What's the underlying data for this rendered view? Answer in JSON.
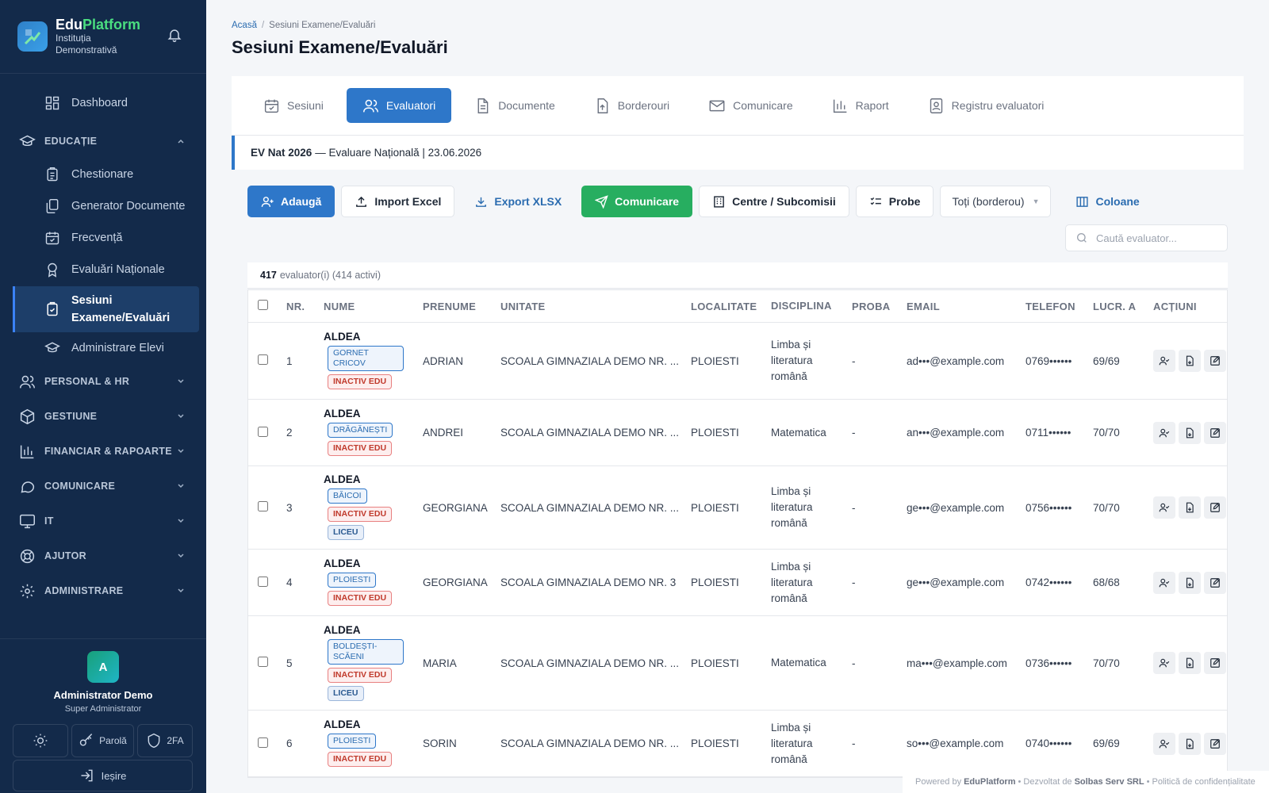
{
  "brand": {
    "name_a": "Edu",
    "name_b": "Platform",
    "sub": "Instituția Demonstrativă"
  },
  "sidebar": {
    "dashboard": "Dashboard",
    "section_educatie": "EDUCAȚIE",
    "edu_items": [
      "Chestionare",
      "Generator Documente",
      "Frecvență",
      "Evaluări Naționale"
    ],
    "active_item": "Sesiuni Examene/Evaluări",
    "admin_elevi": "Administrare Elevi",
    "sections": [
      "PERSONAL & HR",
      "GESTIUNE",
      "FINANCIAR & RAPOARTE",
      "COMUNICARE",
      "IT",
      "AJUTOR",
      "ADMINISTRARE"
    ]
  },
  "user": {
    "initial": "A",
    "name": "Administrator Demo",
    "role": "Super Administrator",
    "btn_parola": "Parolă",
    "btn_2fa": "2FA",
    "logout": "Ieșire"
  },
  "breadcrumb": {
    "home": "Acasă",
    "current": "Sesiuni Examene/Evaluări"
  },
  "page_title": "Sesiuni Examene/Evaluări",
  "tabs": [
    "Sesiuni",
    "Evaluatori",
    "Documente",
    "Borderouri",
    "Comunicare",
    "Raport",
    "Registru evaluatori"
  ],
  "session": {
    "code": "EV Nat 2026",
    "desc": "— Evaluare Națională | 23.06.2026"
  },
  "toolbar": {
    "add": "Adaugă",
    "import": "Import Excel",
    "export": "Export XLSX",
    "comm": "Comunicare",
    "centre": "Centre / Subcomisii",
    "probe": "Probe",
    "filter": "Toți (borderou)",
    "columns": "Coloane"
  },
  "search": {
    "placeholder": "Caută evaluator..."
  },
  "count": {
    "total": "417",
    "label": "evaluator(i) (414 activi)"
  },
  "table": {
    "headers": [
      "NR.",
      "NUME",
      "PRENUME",
      "UNITATE",
      "LOCALITATE",
      "DISCIPLINA",
      "PROBA",
      "EMAIL",
      "TELEFON",
      "LUCR. A",
      "ACȚIUNI"
    ],
    "rows": [
      {
        "nr": "1",
        "nume": "ALDEA",
        "loc_badge": "GORNET CRICOV",
        "status": "INACTIV EDU",
        "liceu": "",
        "prenume": "ADRIAN",
        "unitate": "SCOALA GIMNAZIALA DEMO NR. ...",
        "localitate": "PLOIESTI",
        "disciplina": "Limba și literatura română",
        "proba": "-",
        "email": "ad•••@example.com",
        "telefon": "0769••••••",
        "lucr": "69/69"
      },
      {
        "nr": "2",
        "nume": "ALDEA",
        "loc_badge": "DRĂGĂNEȘTI",
        "status": "INACTIV EDU",
        "liceu": "",
        "prenume": "ANDREI",
        "unitate": "SCOALA GIMNAZIALA DEMO NR. ...",
        "localitate": "PLOIESTI",
        "disciplina": "Matematica",
        "proba": "-",
        "email": "an•••@example.com",
        "telefon": "0711••••••",
        "lucr": "70/70"
      },
      {
        "nr": "3",
        "nume": "ALDEA",
        "loc_badge": "BĂICOI",
        "status": "INACTIV EDU",
        "liceu": "LICEU",
        "prenume": "GEORGIANA",
        "unitate": "SCOALA GIMNAZIALA DEMO NR. ...",
        "localitate": "PLOIESTI",
        "disciplina": "Limba și literatura română",
        "proba": "-",
        "email": "ge•••@example.com",
        "telefon": "0756••••••",
        "lucr": "70/70"
      },
      {
        "nr": "4",
        "nume": "ALDEA",
        "loc_badge": "PLOIESTI",
        "status": "INACTIV EDU",
        "liceu": "",
        "prenume": "GEORGIANA",
        "unitate": "SCOALA GIMNAZIALA DEMO NR. 3",
        "localitate": "PLOIESTI",
        "disciplina": "Limba și literatura română",
        "proba": "-",
        "email": "ge•••@example.com",
        "telefon": "0742••••••",
        "lucr": "68/68"
      },
      {
        "nr": "5",
        "nume": "ALDEA",
        "loc_badge": "BOLDEȘTI-SCĂENI",
        "status": "INACTIV EDU",
        "liceu": "LICEU",
        "prenume": "MARIA",
        "unitate": "SCOALA GIMNAZIALA DEMO NR. ...",
        "localitate": "PLOIESTI",
        "disciplina": "Matematica",
        "proba": "-",
        "email": "ma•••@example.com",
        "telefon": "0736••••••",
        "lucr": "70/70"
      },
      {
        "nr": "6",
        "nume": "ALDEA",
        "loc_badge": "PLOIESTI",
        "status": "INACTIV EDU",
        "liceu": "",
        "prenume": "SORIN",
        "unitate": "SCOALA GIMNAZIALA DEMO NR. ...",
        "localitate": "PLOIESTI",
        "disciplina": "Limba și literatura română",
        "proba": "-",
        "email": "so•••@example.com",
        "telefon": "0740••••••",
        "lucr": "69/69"
      }
    ]
  },
  "footer": {
    "powered": "Powered by",
    "brand": "EduPlatform",
    "dev": "• Dezvoltat de",
    "company": "Solbas Serv SRL",
    "privacy": "• Politică de confidențialitate"
  },
  "colors": {
    "sidebar": "#132a4a",
    "accent": "#2e77c9",
    "success": "#27ae60",
    "danger": "#c0392b"
  }
}
